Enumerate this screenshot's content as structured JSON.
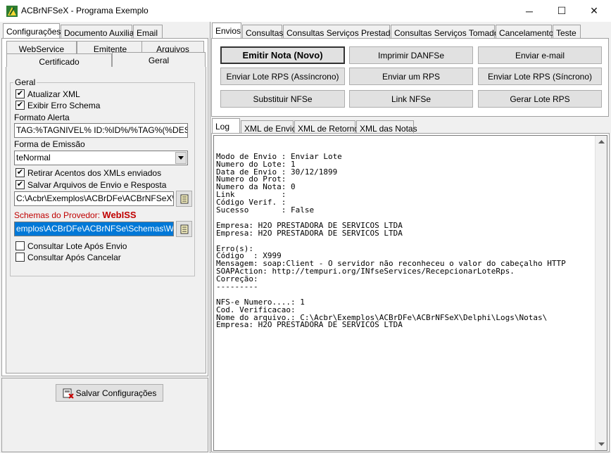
{
  "window": {
    "title": "ACBrNFSeX - Programa Exemplo",
    "minimize": "─",
    "maximize": "☐",
    "close": "✕"
  },
  "left": {
    "top_tabs": [
      "Configurações",
      "Documento Auxiliar",
      "Email"
    ],
    "sub_tabs_row1": [
      "WebService",
      "Emitente",
      "Arquivos"
    ],
    "sub_tabs_row2": [
      "Certificado",
      "Geral"
    ],
    "group_title": "Geral",
    "atualizar_xml": {
      "label": "Atualizar XML",
      "checked": true
    },
    "exibir_erro": {
      "label": "Exibir Erro Schema",
      "checked": true
    },
    "formato_alerta_label": "Formato Alerta",
    "formato_alerta_value": "TAG:%TAGNIVEL% ID:%ID%/%TAG%(%DESCRI",
    "forma_emissao_label": "Forma de Emissão",
    "forma_emissao_value": "teNormal",
    "retirar_acentos": {
      "label": "Retirar Acentos dos XMLs enviados",
      "checked": true
    },
    "salvar_arquivos": {
      "label": "Salvar Arquivos de Envio e Resposta",
      "checked": true
    },
    "path_value": "C:\\Acbr\\Exemplos\\ACBrDFe\\ACBrNFSeX\\Delph",
    "schemas_label": "Schemas do Provedor:",
    "schemas_provider": "WebISS",
    "schemas_value": "emplos\\ACBrDFe\\ACBrNFSe\\Schemas\\WebISS",
    "consultar_lote": {
      "label": "Consultar Lote Após Envio",
      "checked": false
    },
    "consultar_cancelar": {
      "label": "Consultar Após Cancelar",
      "checked": false
    },
    "save_button": "Salvar Configurações"
  },
  "right": {
    "top_tabs": [
      "Envios",
      "Consultas",
      "Consultas Serviços Prestados",
      "Consultas Serviços Tomados",
      "Cancelamento",
      "Teste"
    ],
    "buttons": [
      [
        "Emitir Nota (Novo)",
        "Imprimir DANFSe",
        "Enviar e-mail"
      ],
      [
        "Enviar Lote RPS (Assíncrono)",
        "Enviar um RPS",
        "Enviar Lote RPS (Síncrono)"
      ],
      [
        "Substituir NFSe",
        "Link NFSe",
        "Gerar Lote RPS"
      ]
    ],
    "log_tabs": [
      "Log",
      "XML de Envio",
      "XML de Retorno",
      "XML das Notas"
    ],
    "log_lines": [
      "Modo de Envio : Enviar Lote",
      "Numero do Lote: 1",
      "Data de Envio : 30/12/1899",
      "Numero do Prot:",
      "Numero da Nota: 0",
      "Link          :",
      "Código Verif. :",
      "Sucesso       : False",
      "",
      "Empresa: H2O PRESTADORA DE SERVICOS LTDA",
      "Empresa: H2O PRESTADORA DE SERVICOS LTDA",
      "",
      "Erro(s):",
      "Código  : X999",
      "Mensagem: soap:Client - O servidor não reconheceu o valor do cabeçalho HTTP",
      "SOAPAction: http://tempuri.org/INfseServices/RecepcionarLoteRps.",
      "Correção:",
      "---------",
      "",
      "NFS-e Numero....: 1",
      "Cod. Verificacao:",
      "Nome do arquivo.: C:\\Acbr\\Exemplos\\ACBrDFe\\ACBrNFSeX\\Delphi\\Logs\\Notas\\",
      "Empresa: H2O PRESTADORA DE SERVICOS LTDA"
    ]
  }
}
